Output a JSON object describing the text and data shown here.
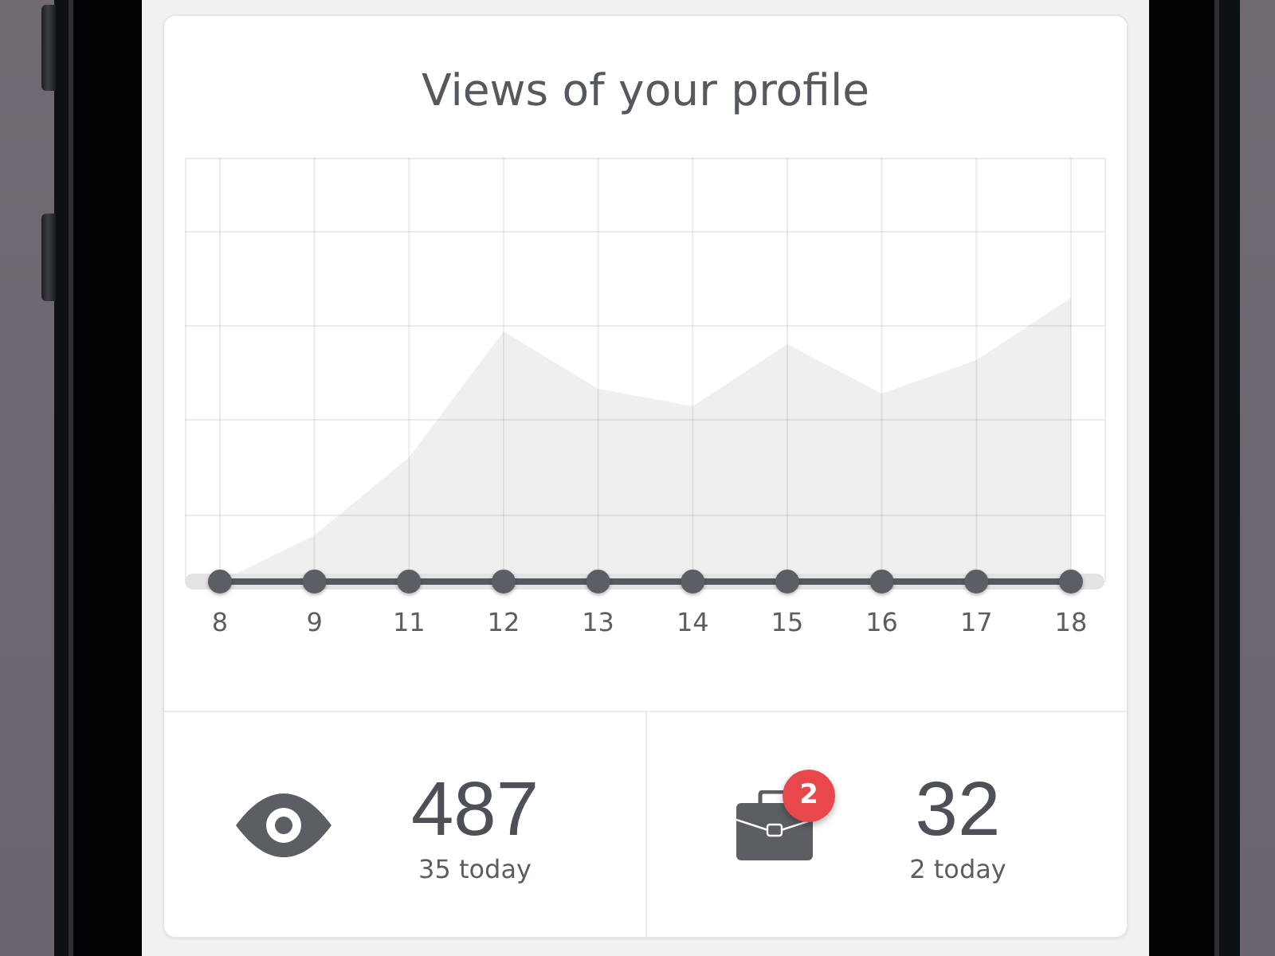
{
  "card": {
    "title": "Views of your profile",
    "chart": {
      "x_labels": [
        "8",
        "9",
        "11",
        "12",
        "13",
        "14",
        "15",
        "16",
        "17",
        "18"
      ]
    }
  },
  "stats": [
    {
      "kind": "views",
      "value": "487",
      "caption": "35 today"
    },
    {
      "kind": "jobs",
      "value": "32",
      "caption": "2 today",
      "badge": "2"
    }
  ]
}
